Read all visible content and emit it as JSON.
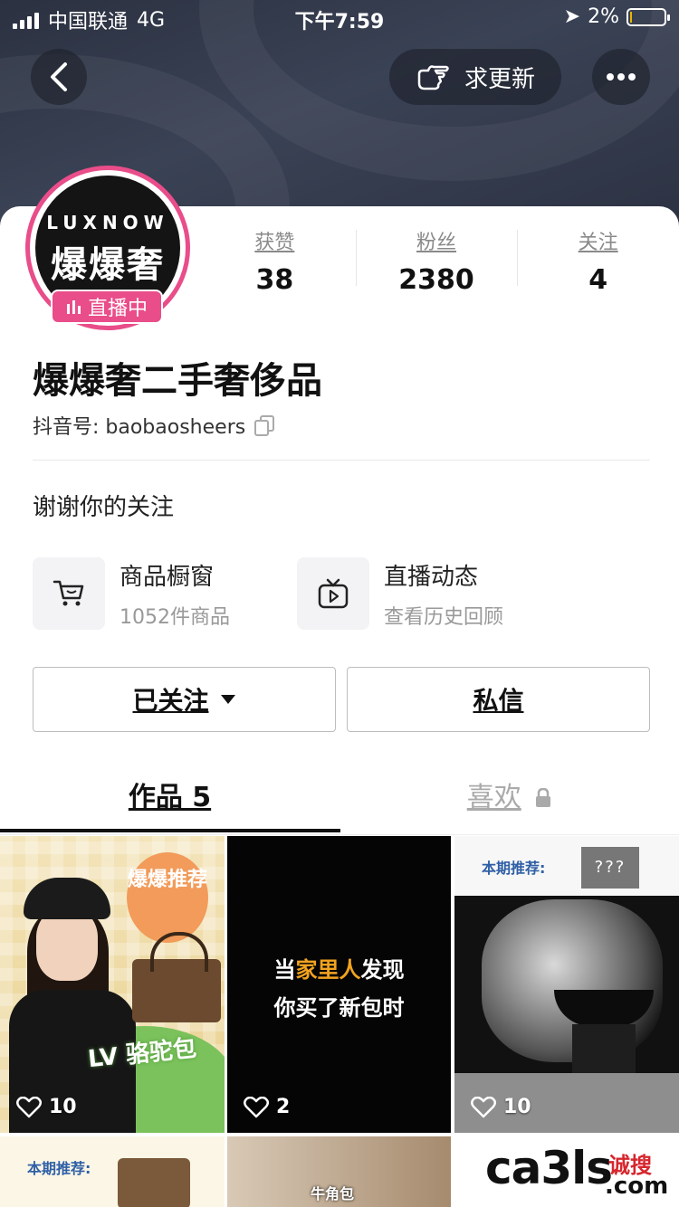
{
  "status_bar": {
    "carrier": "中国联通",
    "network": "4G",
    "time": "下午7:59",
    "battery": "2%"
  },
  "header": {
    "update_label": "求更新"
  },
  "profile": {
    "avatar_brand": "LUXNOW",
    "avatar_brand_cn": "爆爆奢",
    "live_badge": "直播中",
    "name": "爆爆奢二手奢侈品",
    "douyin_id_label": "抖音号: baobaosheers",
    "bio": "谢谢你的关注"
  },
  "stats": [
    {
      "label": "获赞",
      "value": "38"
    },
    {
      "label": "粉丝",
      "value": "2380"
    },
    {
      "label": "关注",
      "value": "4"
    }
  ],
  "features": [
    {
      "title": "商品橱窗",
      "subtitle": "1052件商品",
      "icon": "cart-icon"
    },
    {
      "title": "直播动态",
      "subtitle": "查看历史回顾",
      "icon": "tv-play-icon"
    }
  ],
  "buttons": {
    "follow": "已关注",
    "message": "私信"
  },
  "tabs": {
    "works": "作品 5",
    "likes": "喜欢"
  },
  "videos": [
    {
      "likes": "10",
      "bubble": "爆爆推荐",
      "title": "LV 骆驼包"
    },
    {
      "likes": "2",
      "line1_a": "当",
      "line1_b": "家里人",
      "line1_c": "发现",
      "line2": "你买了新包时"
    },
    {
      "likes": "10",
      "rec": "本期推荐:",
      "qs": "???"
    },
    {
      "rec": "本期推荐:"
    },
    {
      "tag": "牛角包"
    }
  ],
  "watermark": {
    "logo": "ca3ls",
    "cn": "诚搜",
    "com": ".com"
  },
  "colors": {
    "live_pink": "#e94d8a",
    "accent_orange": "#f2a31f"
  }
}
